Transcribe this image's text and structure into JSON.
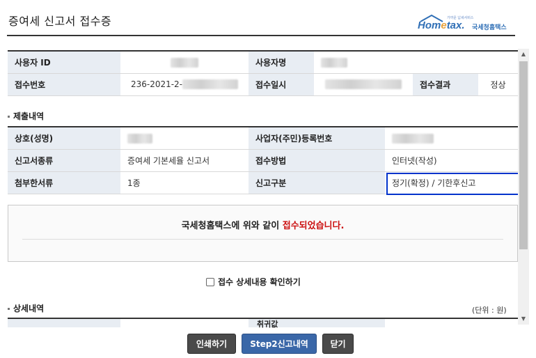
{
  "header": {
    "title": "증여세 신고서 접수증",
    "logo": {
      "text_main": "Hometax",
      "text_accent": "e",
      "text_kr": "국세청홈택스",
      "tagline": "가까운 납세서비스"
    }
  },
  "user_table": {
    "user_id_label": "사용자 ID",
    "user_name_label": "사용자명",
    "receipt_no_label": "접수번호",
    "receipt_no_value": "236-2021-2-",
    "receipt_date_label": "접수일시",
    "receipt_result_label": "접수결과",
    "receipt_result_value": "정상"
  },
  "submission": {
    "section_title": "제출내역",
    "name_label": "상호(성명)",
    "reg_no_label": "사업자(주민)등록번호",
    "report_type_label": "신고서종류",
    "report_type_value": "증여세 기본세율 신고서",
    "method_label": "접수방법",
    "method_value": "인터넷(작성)",
    "attach_label": "첨부한서류",
    "attach_value": "1종",
    "category_label": "신고구분",
    "category_value": "정기(확정) / 기한후신고"
  },
  "notice": {
    "prefix": "국세청홈택스에 위와 같이 ",
    "highlight": "접수되었습니다.",
    "colors": {
      "highlight": "#cc1111"
    }
  },
  "confirm": {
    "label": "접수 상세내용 확인하기",
    "checked": false
  },
  "detail": {
    "section_title": "상세내역",
    "unit": "(단위 : 원)",
    "partial_label": "취귀값"
  },
  "buttons": {
    "print": "인쇄하기",
    "step2": "Step2신고내역",
    "close": "닫기"
  }
}
